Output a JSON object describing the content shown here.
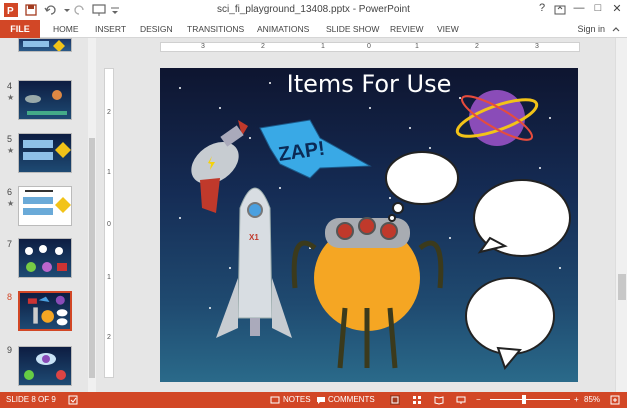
{
  "window": {
    "title": "sci_fi_playground_13408.pptx - PowerPoint",
    "help_glyph": "?",
    "minimize_glyph": "—",
    "restore_glyph": "□",
    "close_glyph": "✕"
  },
  "qat": {
    "save_icon": "save-icon",
    "undo_icon": "undo-icon",
    "redo_icon": "redo-icon",
    "present_icon": "present-icon"
  },
  "ribbon": {
    "file": "FILE",
    "tabs": [
      "HOME",
      "INSERT",
      "DESIGN",
      "TRANSITIONS",
      "ANIMATIONS",
      "SLIDE SHOW",
      "REVIEW",
      "VIEW"
    ],
    "signin": "Sign in"
  },
  "thumbnails": [
    {
      "num": "4",
      "star": "★"
    },
    {
      "num": "5",
      "star": "★"
    },
    {
      "num": "6",
      "star": "★"
    },
    {
      "num": "7",
      "star": ""
    },
    {
      "num": "8",
      "star": ""
    },
    {
      "num": "9",
      "star": ""
    }
  ],
  "rulers": {
    "h": [
      "3",
      "2",
      "1",
      "0",
      "1",
      "2",
      "3"
    ],
    "v": [
      "2",
      "1",
      "0",
      "1",
      "2"
    ]
  },
  "slide": {
    "title": "Items For Use",
    "zap": "ZAP!",
    "rocket_label": "X1"
  },
  "status": {
    "slide": "SLIDE 8 OF 9",
    "notes": "NOTES",
    "comments": "COMMENTS",
    "zoom": "85%"
  },
  "colors": {
    "accent": "#d24726",
    "slide_bg": "#152c55"
  }
}
